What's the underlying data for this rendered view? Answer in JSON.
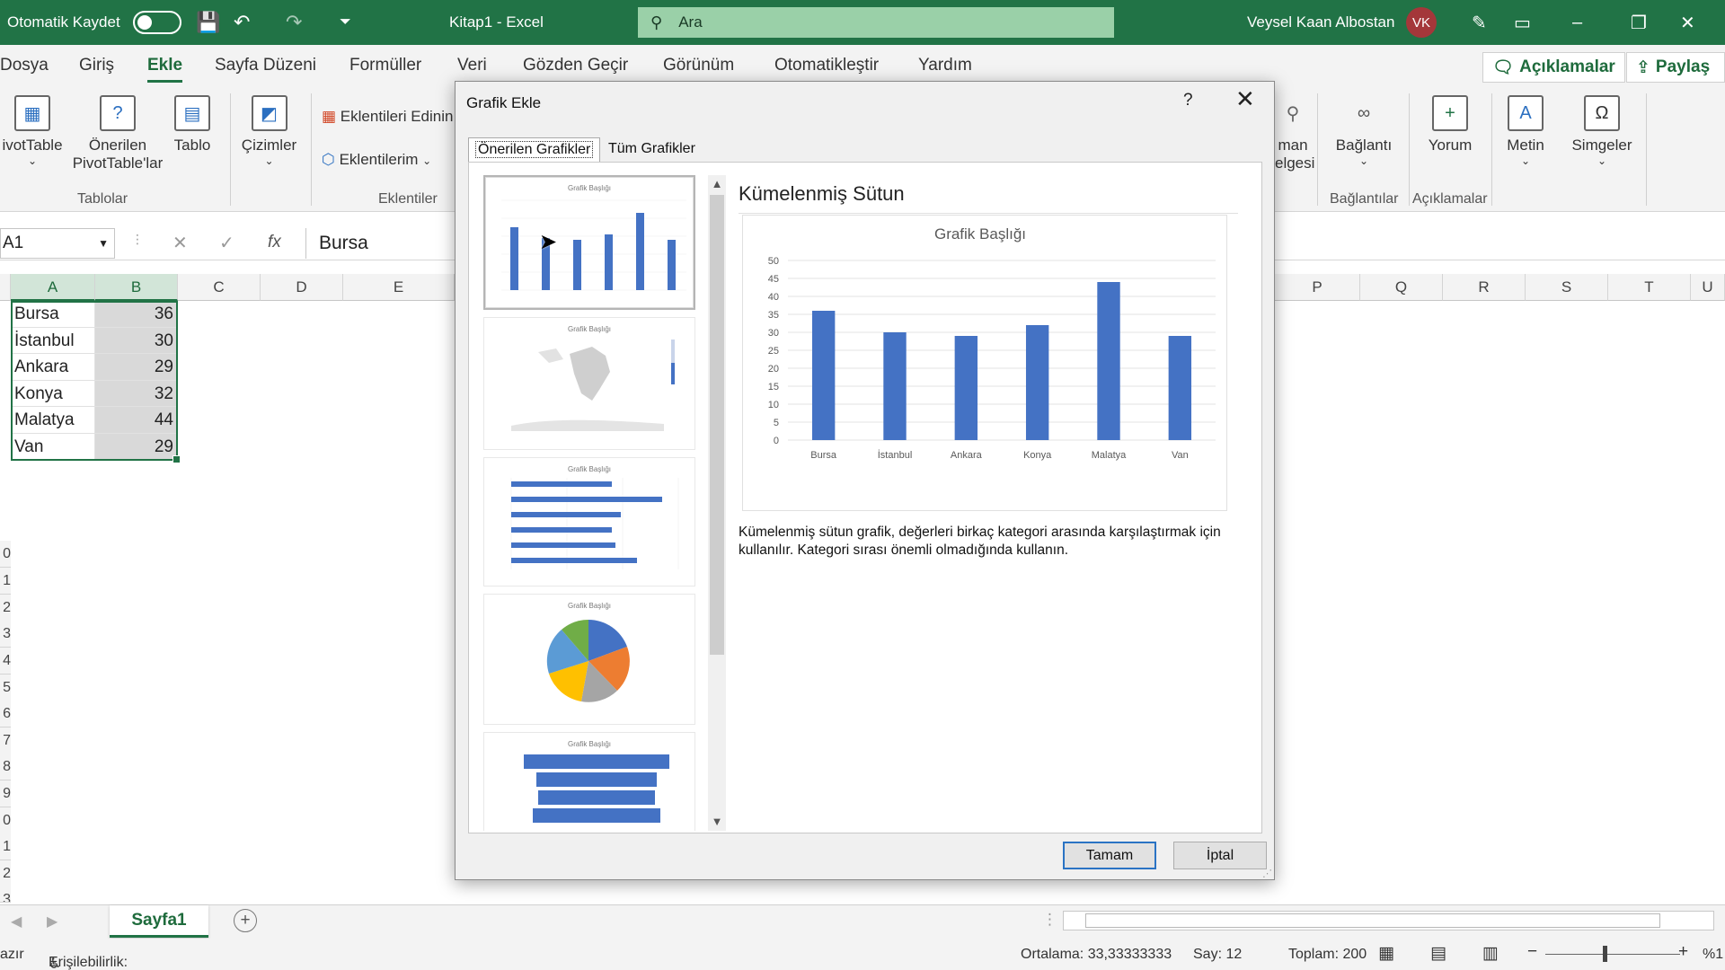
{
  "titlebar": {
    "autosave_label": "Otomatik Kaydet",
    "document_title": "Kitap1 - Excel",
    "search_placeholder": "Ara",
    "user_name": "Veysel Kaan Albostan",
    "user_initials": "VK"
  },
  "menu": {
    "tabs": [
      "Dosya",
      "Giriş",
      "Ekle",
      "Sayfa Düzeni",
      "Formüller",
      "Veri",
      "Gözden Geçir",
      "Görünüm",
      "Otomatikleştir",
      "Yardım"
    ],
    "active_tab": "Ekle",
    "comments_label": "Açıklamalar",
    "share_label": "Paylaş"
  },
  "ribbon": {
    "pivottable": "ivotTable",
    "recommended_pivot_1": "Önerilen",
    "recommended_pivot_2": "PivotTable'lar",
    "table": "Tablo",
    "drawings": "Çizimler",
    "get_addins": "Eklentileri Edinin",
    "my_addins": "Eklentilerim",
    "partial_1": "man",
    "partial_2": "elgesi",
    "link": "Bağlantı",
    "comment": "Yorum",
    "text": "Metin",
    "symbols": "Simgeler",
    "group_tables": "Tablolar",
    "group_addins": "Eklentiler",
    "group_links": "Bağlantılar",
    "group_comments": "Açıklamalar"
  },
  "formula_bar": {
    "name_box": "A1",
    "fx": "fx",
    "value": "Bursa"
  },
  "grid": {
    "left_columns": [
      "A",
      "B",
      "C",
      "D",
      "E"
    ],
    "right_columns": [
      "P",
      "Q",
      "R",
      "S",
      "T",
      "U"
    ],
    "rows": [
      {
        "name": "Bursa",
        "value": "36"
      },
      {
        "name": "İstanbul",
        "value": "30"
      },
      {
        "name": "Ankara",
        "value": "29"
      },
      {
        "name": "Konya",
        "value": "32"
      },
      {
        "name": "Malatya",
        "value": "44"
      },
      {
        "name": "Van",
        "value": "29"
      }
    ],
    "row_numbers_partial": [
      "0",
      "1",
      "2",
      "3",
      "4",
      "5",
      "6",
      "7",
      "8",
      "9",
      "0",
      "1",
      "2",
      "3"
    ]
  },
  "sheet": {
    "tab_name": "Sayfa1"
  },
  "status": {
    "ready_partial": "azır",
    "accessibility": "Erişilebilirlik: Her şey hazır",
    "average": "Ortalama: 33,33333333",
    "count": "Say: 12",
    "sum": "Toplam: 200",
    "zoom_partial": "%1"
  },
  "dialog": {
    "title": "Grafik Ekle",
    "help": "?",
    "tab_recommended": "Önerilen Grafikler",
    "tab_all": "Tüm Grafikler",
    "preview_title": "Kümelenmiş Sütun",
    "description": "Kümelenmiş sütun grafik, değerleri birkaç kategori arasında karşılaştırmak için kullanılır. Kategori sırası önemli olmadığında kullanın.",
    "ok_label": "Tamam",
    "cancel_label": "İptal",
    "thumbnail_title": "Grafik Başlığı"
  },
  "chart_data": {
    "type": "bar",
    "title": "Grafik Başlığı",
    "categories": [
      "Bursa",
      "İstanbul",
      "Ankara",
      "Konya",
      "Malatya",
      "Van"
    ],
    "values": [
      36,
      30,
      29,
      32,
      44,
      29
    ],
    "yticks": [
      0,
      5,
      10,
      15,
      20,
      25,
      30,
      35,
      40,
      45,
      50
    ],
    "ylim": [
      0,
      50
    ],
    "xlabel": "",
    "ylabel": "",
    "grid": true,
    "bar_color": "#4472c4"
  },
  "colors": {
    "excel_green": "#217346",
    "chart_blue": "#4472c4"
  }
}
